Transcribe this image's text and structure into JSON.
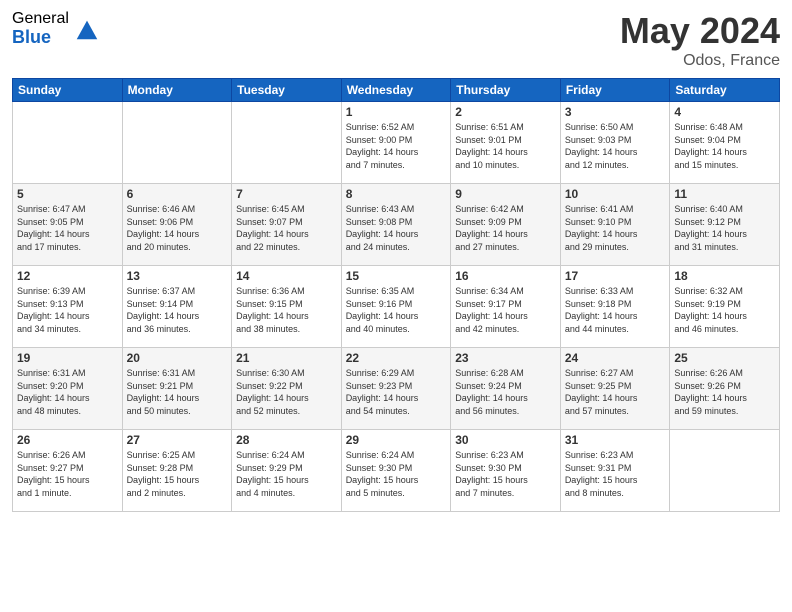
{
  "header": {
    "logo_general": "General",
    "logo_blue": "Blue",
    "month_title": "May 2024",
    "location": "Odos, France"
  },
  "days_of_week": [
    "Sunday",
    "Monday",
    "Tuesday",
    "Wednesday",
    "Thursday",
    "Friday",
    "Saturday"
  ],
  "weeks": [
    [
      {
        "day": "",
        "info": ""
      },
      {
        "day": "",
        "info": ""
      },
      {
        "day": "",
        "info": ""
      },
      {
        "day": "1",
        "info": "Sunrise: 6:52 AM\nSunset: 9:00 PM\nDaylight: 14 hours\nand 7 minutes."
      },
      {
        "day": "2",
        "info": "Sunrise: 6:51 AM\nSunset: 9:01 PM\nDaylight: 14 hours\nand 10 minutes."
      },
      {
        "day": "3",
        "info": "Sunrise: 6:50 AM\nSunset: 9:03 PM\nDaylight: 14 hours\nand 12 minutes."
      },
      {
        "day": "4",
        "info": "Sunrise: 6:48 AM\nSunset: 9:04 PM\nDaylight: 14 hours\nand 15 minutes."
      }
    ],
    [
      {
        "day": "5",
        "info": "Sunrise: 6:47 AM\nSunset: 9:05 PM\nDaylight: 14 hours\nand 17 minutes."
      },
      {
        "day": "6",
        "info": "Sunrise: 6:46 AM\nSunset: 9:06 PM\nDaylight: 14 hours\nand 20 minutes."
      },
      {
        "day": "7",
        "info": "Sunrise: 6:45 AM\nSunset: 9:07 PM\nDaylight: 14 hours\nand 22 minutes."
      },
      {
        "day": "8",
        "info": "Sunrise: 6:43 AM\nSunset: 9:08 PM\nDaylight: 14 hours\nand 24 minutes."
      },
      {
        "day": "9",
        "info": "Sunrise: 6:42 AM\nSunset: 9:09 PM\nDaylight: 14 hours\nand 27 minutes."
      },
      {
        "day": "10",
        "info": "Sunrise: 6:41 AM\nSunset: 9:10 PM\nDaylight: 14 hours\nand 29 minutes."
      },
      {
        "day": "11",
        "info": "Sunrise: 6:40 AM\nSunset: 9:12 PM\nDaylight: 14 hours\nand 31 minutes."
      }
    ],
    [
      {
        "day": "12",
        "info": "Sunrise: 6:39 AM\nSunset: 9:13 PM\nDaylight: 14 hours\nand 34 minutes."
      },
      {
        "day": "13",
        "info": "Sunrise: 6:37 AM\nSunset: 9:14 PM\nDaylight: 14 hours\nand 36 minutes."
      },
      {
        "day": "14",
        "info": "Sunrise: 6:36 AM\nSunset: 9:15 PM\nDaylight: 14 hours\nand 38 minutes."
      },
      {
        "day": "15",
        "info": "Sunrise: 6:35 AM\nSunset: 9:16 PM\nDaylight: 14 hours\nand 40 minutes."
      },
      {
        "day": "16",
        "info": "Sunrise: 6:34 AM\nSunset: 9:17 PM\nDaylight: 14 hours\nand 42 minutes."
      },
      {
        "day": "17",
        "info": "Sunrise: 6:33 AM\nSunset: 9:18 PM\nDaylight: 14 hours\nand 44 minutes."
      },
      {
        "day": "18",
        "info": "Sunrise: 6:32 AM\nSunset: 9:19 PM\nDaylight: 14 hours\nand 46 minutes."
      }
    ],
    [
      {
        "day": "19",
        "info": "Sunrise: 6:31 AM\nSunset: 9:20 PM\nDaylight: 14 hours\nand 48 minutes."
      },
      {
        "day": "20",
        "info": "Sunrise: 6:31 AM\nSunset: 9:21 PM\nDaylight: 14 hours\nand 50 minutes."
      },
      {
        "day": "21",
        "info": "Sunrise: 6:30 AM\nSunset: 9:22 PM\nDaylight: 14 hours\nand 52 minutes."
      },
      {
        "day": "22",
        "info": "Sunrise: 6:29 AM\nSunset: 9:23 PM\nDaylight: 14 hours\nand 54 minutes."
      },
      {
        "day": "23",
        "info": "Sunrise: 6:28 AM\nSunset: 9:24 PM\nDaylight: 14 hours\nand 56 minutes."
      },
      {
        "day": "24",
        "info": "Sunrise: 6:27 AM\nSunset: 9:25 PM\nDaylight: 14 hours\nand 57 minutes."
      },
      {
        "day": "25",
        "info": "Sunrise: 6:26 AM\nSunset: 9:26 PM\nDaylight: 14 hours\nand 59 minutes."
      }
    ],
    [
      {
        "day": "26",
        "info": "Sunrise: 6:26 AM\nSunset: 9:27 PM\nDaylight: 15 hours\nand 1 minute."
      },
      {
        "day": "27",
        "info": "Sunrise: 6:25 AM\nSunset: 9:28 PM\nDaylight: 15 hours\nand 2 minutes."
      },
      {
        "day": "28",
        "info": "Sunrise: 6:24 AM\nSunset: 9:29 PM\nDaylight: 15 hours\nand 4 minutes."
      },
      {
        "day": "29",
        "info": "Sunrise: 6:24 AM\nSunset: 9:30 PM\nDaylight: 15 hours\nand 5 minutes."
      },
      {
        "day": "30",
        "info": "Sunrise: 6:23 AM\nSunset: 9:30 PM\nDaylight: 15 hours\nand 7 minutes."
      },
      {
        "day": "31",
        "info": "Sunrise: 6:23 AM\nSunset: 9:31 PM\nDaylight: 15 hours\nand 8 minutes."
      },
      {
        "day": "",
        "info": ""
      }
    ]
  ]
}
